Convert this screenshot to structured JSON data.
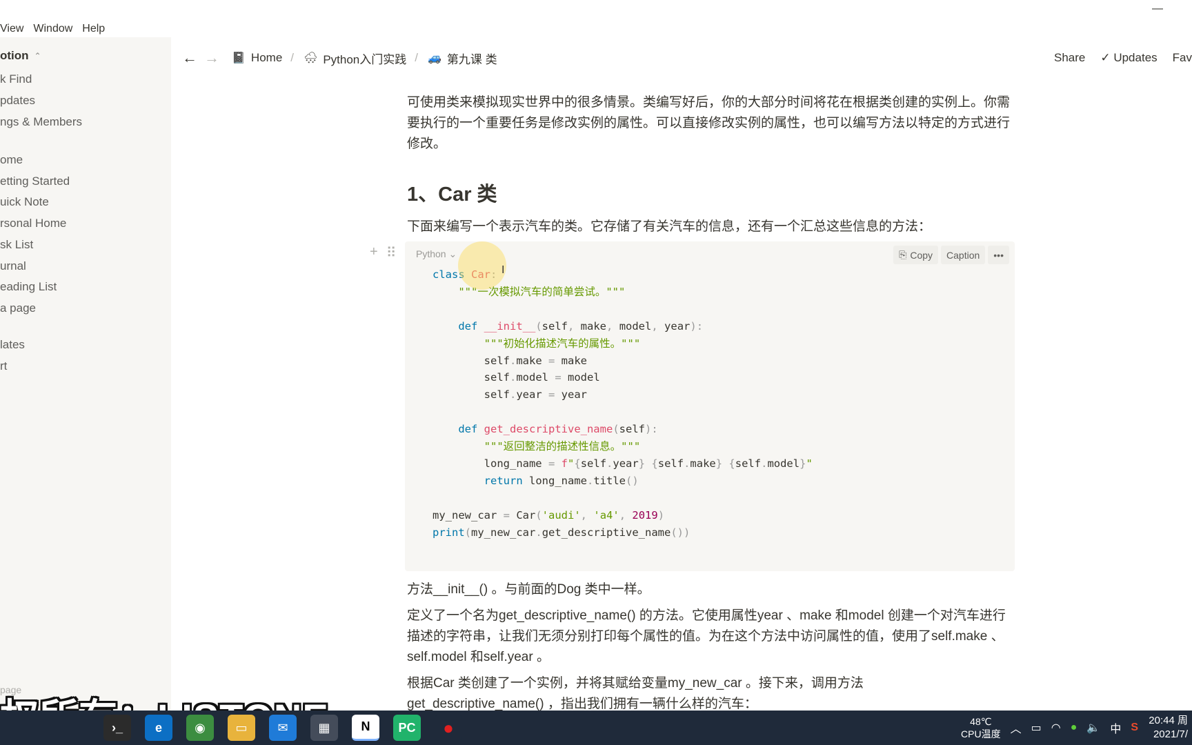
{
  "window": {
    "minimize_glyph": "—",
    "menu": [
      "View",
      "Window",
      "Help"
    ]
  },
  "sidebar": {
    "workspace": "otion",
    "items_top": [
      "k Find",
      "pdates",
      "ngs & Members"
    ],
    "pages": [
      "ome",
      "etting Started",
      "uick Note",
      "rsonal Home",
      "sk List",
      "urnal",
      "eading List",
      "a page"
    ],
    "items_bottom": [
      "lates",
      "rt"
    ],
    "new_page": "page"
  },
  "topbar": {
    "back_glyph": "←",
    "forward_glyph": "→",
    "breadcrumbs": [
      {
        "icon": "📓",
        "label": "Home"
      },
      {
        "icon": "🌨",
        "label": "Python入门实践"
      },
      {
        "icon": "🚙",
        "label": "第九课 类"
      }
    ],
    "separator": "/",
    "share": "Share",
    "updates": "Updates",
    "favorite": "Fav"
  },
  "content": {
    "intro": "可使用类来模拟现实世界中的很多情景。类编写好后，你的大部分时间将花在根据类创建的实例上。你需要执行的一个重要任务是修改实例的属性。可以直接修改实例的属性，也可以编写方法以特定的方式进行修改。",
    "heading": "1、Car 类",
    "lead": "下面来编写一个表示汽车的类。它存储了有关汽车的信息，还有一个汇总这些信息的方法：",
    "code": {
      "language": "Python",
      "copy": "Copy",
      "caption": "Caption",
      "more": "•••"
    },
    "after": [
      "方法__init__() 。与前面的Dog 类中一样。",
      "定义了一个名为get_descriptive_name() 的方法。它使用属性year 、make 和model 创建一个对汽车进行描述的字符串，让我们无须分别打印每个属性的值。为在这个方法中访问属性的值，使用了self.make 、self.model 和self.year 。",
      "根据Car 类创建了一个实例，并将其赋给变量my_new_car 。接下来，调用方法",
      "get_descriptive_name() ，指出我们拥有一辆什么样的汽车："
    ]
  },
  "watermark": "权所有：LISTONE",
  "taskbar": {
    "temp": "48℃",
    "temp_label": "CPU温度",
    "ime": "中",
    "time": "20:44 周",
    "date": "2021/7/"
  }
}
